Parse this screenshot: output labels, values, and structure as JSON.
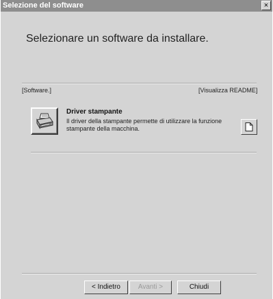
{
  "window": {
    "title": "Selezione del software",
    "close_glyph": "×"
  },
  "header": {
    "text": "Selezionare un software da installare."
  },
  "columns": {
    "software_label": "[Software.]",
    "readme_label": "[Visualizza README]"
  },
  "software_item": {
    "icon": "printer-icon",
    "title": "Driver stampante",
    "description": "Il driver della stampante permette di utilizzare la funzione stampante della macchina.",
    "readme_icon": "document-icon"
  },
  "buttons": {
    "back": "< Indietro",
    "next": "Avanti >",
    "close": "Chiudi"
  },
  "colors": {
    "title_bar": "#8e8e8e",
    "dialog_bg": "#d4d4d4"
  }
}
